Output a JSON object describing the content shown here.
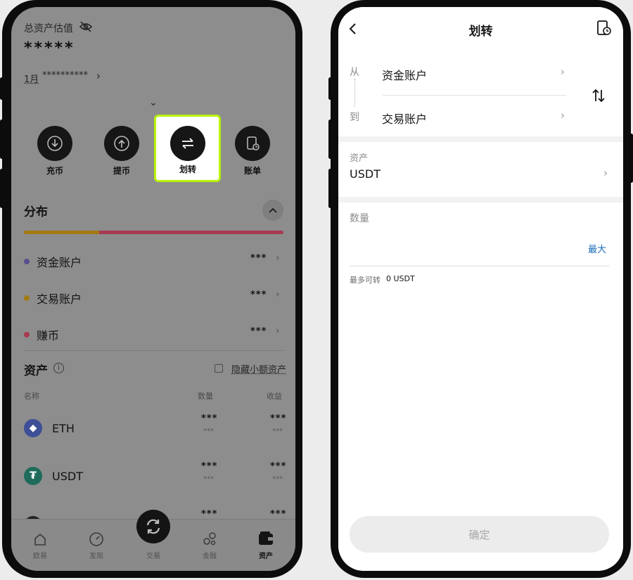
{
  "left": {
    "total_label": "总资产估值",
    "hidden_total": "*****",
    "period_label": "1月",
    "period_value": "**********",
    "actions": [
      {
        "label": "充币",
        "icon": "download-icon"
      },
      {
        "label": "提币",
        "icon": "upload-icon"
      },
      {
        "label": "划转",
        "icon": "transfer-icon"
      },
      {
        "label": "账单",
        "icon": "bill-icon"
      }
    ],
    "distribution_title": "分布",
    "accounts": [
      {
        "name": "资金账户",
        "value": "***",
        "color": "#5a4f8e"
      },
      {
        "name": "交易账户",
        "value": "***",
        "color": "#a37a12"
      },
      {
        "name": "赚币",
        "value": "***",
        "color": "#a83a52"
      }
    ],
    "assets_title": "资产",
    "hide_small_label": "隐藏小额资产",
    "columns": {
      "name": "名称",
      "quantity": "数量",
      "profit": "收益"
    },
    "coins": [
      {
        "symbol": "ETH",
        "qty": "***",
        "qty_sub": "***",
        "profit": "***",
        "profit_sub": "***",
        "color": "#3d4f97"
      },
      {
        "symbol": "USDT",
        "qty": "***",
        "qty_sub": "***",
        "profit": "***",
        "profit_sub": "***",
        "color": "#1f6b5b"
      },
      {
        "symbol": "",
        "qty": "***",
        "qty_sub": "",
        "profit": "***",
        "profit_sub": "",
        "color": "#222222"
      }
    ],
    "nav": [
      {
        "label": "欧易",
        "icon": "home-icon"
      },
      {
        "label": "发现",
        "icon": "discover-icon"
      },
      {
        "label": "交易",
        "icon": "trade-icon"
      },
      {
        "label": "金融",
        "icon": "finance-icon"
      },
      {
        "label": "资产",
        "icon": "wallet-icon"
      }
    ],
    "highlight_color": "#b9f20a"
  },
  "right": {
    "title": "划转",
    "from_label": "从",
    "from_account": "资金账户",
    "to_label": "到",
    "to_account": "交易账户",
    "asset_label": "资产",
    "asset_value": "USDT",
    "amount_label": "数量",
    "amount_placeholder": "",
    "max_label": "最大",
    "available_prefix": "最多可转",
    "available_value": "0 USDT",
    "confirm_label": "确定",
    "accent_color": "#1b6bb8"
  }
}
